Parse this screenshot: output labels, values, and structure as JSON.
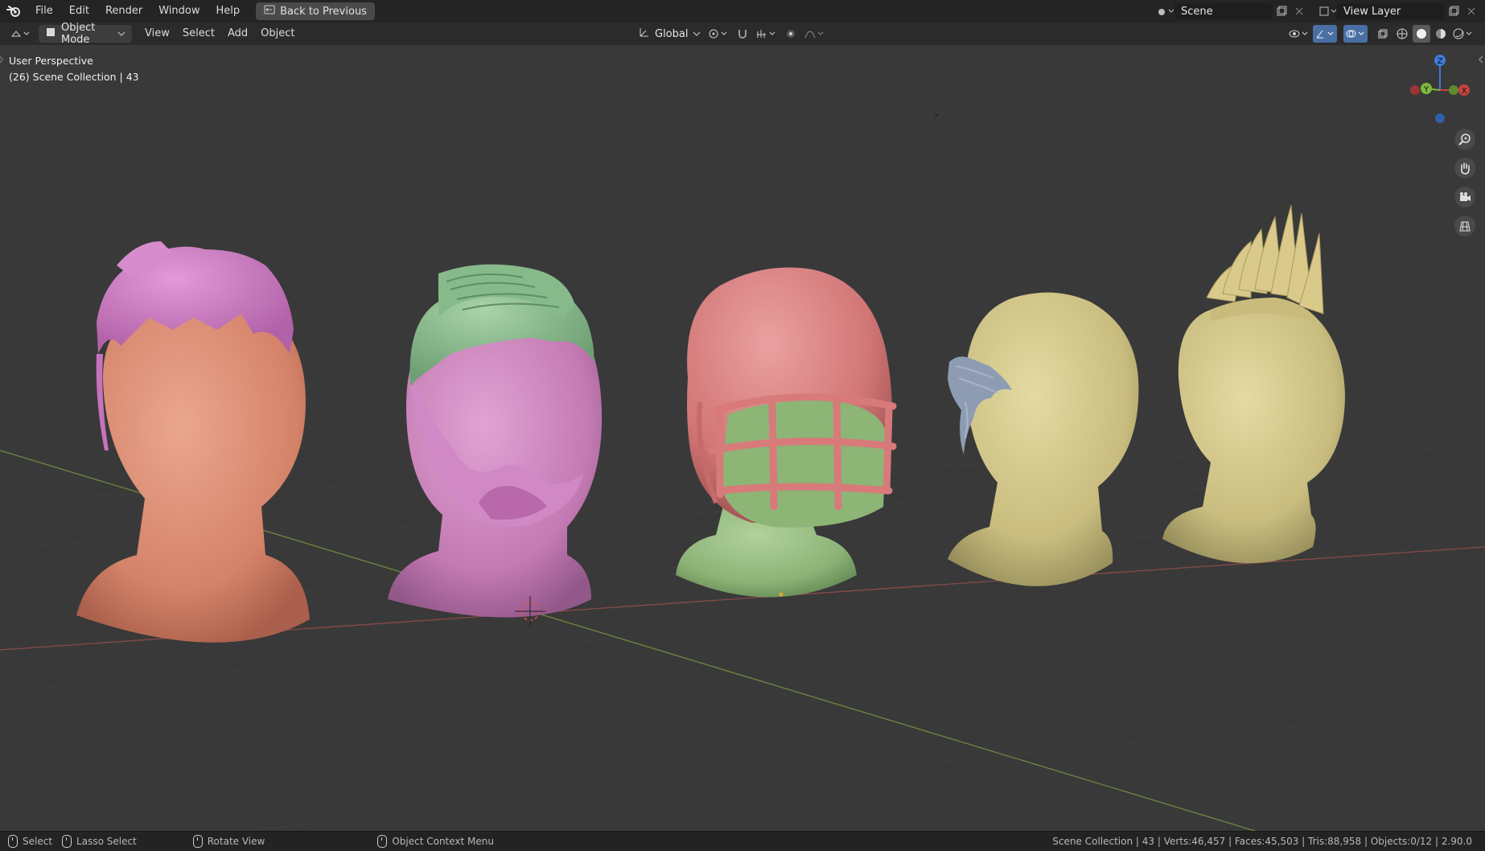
{
  "topbar": {
    "menus": [
      "File",
      "Edit",
      "Render",
      "Window",
      "Help"
    ],
    "back_label": "Back to Previous",
    "scene_value": "Scene",
    "view_layer_value": "View Layer"
  },
  "toolbar": {
    "mode_label": "Object Mode",
    "menus": [
      "View",
      "Select",
      "Add",
      "Object"
    ],
    "transform_orientation": "Global"
  },
  "viewport": {
    "perspective_label": "User Perspective",
    "collection_label": "(26) Scene Collection | 43",
    "gizmo": {
      "z": "Z",
      "y": "Y",
      "x": "X"
    }
  },
  "statusbar": {
    "select_label": "Select",
    "lasso_label": "Lasso Select",
    "rotate_label": "Rotate View",
    "context_label": "Object Context Menu",
    "stats": "Scene Collection | 43 | Verts:46,457 | Faces:45,503 | Tris:88,958 | Objects:0/12 | 2.90.0"
  },
  "colors": {
    "viewport_bg": "#393939",
    "head_orange": "#d98a72",
    "head_pink": "#c97fb9",
    "helmet_red": "#d67b7b",
    "head_green": "#8fb57a",
    "head_yellow": "#c8bd7f",
    "hair_blue": "#8e9cb3",
    "axis_x": "#c8433e",
    "axis_y": "#7fb83c",
    "axis_z": "#3d7bd8"
  }
}
